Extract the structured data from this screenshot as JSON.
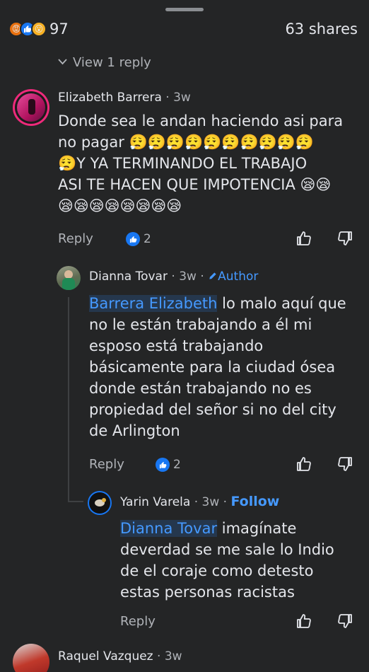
{
  "reactions": {
    "count": "97",
    "icons": [
      "angry-reaction",
      "like-reaction",
      "wow-reaction"
    ]
  },
  "shares": "63 shares",
  "view_reply": "View 1 reply",
  "comments": [
    {
      "name": "Elizabeth Barrera",
      "time": "3w",
      "text_line1": "Donde sea le andan haciendo asi para",
      "text_line2": "no pagar",
      "text_line3": "Y YA TERMINANDO EL TRABAJO",
      "text_line4": "ASI TE HACEN QUE IMPOTENCIA",
      "emoji_a": "😮‍💨😮‍💨😮‍💨😮‍💨😮‍💨😮‍💨😮‍💨😮‍💨😮‍💨😮‍💨",
      "emoji_b": "😮‍💨",
      "emoji_c": "😪😪",
      "emoji_d": "😪😪😪😪😪😪😪😪",
      "reply_label": "Reply",
      "likes": "2"
    },
    {
      "name": "Dianna Tovar",
      "time": "3w",
      "author_label": "Author",
      "mention": "Barrera Elizabeth",
      "text_line1": " lo malo aquí que",
      "text_line2": "no le están trabajando a él mi",
      "text_line3": "esposo está trabajando",
      "text_line4": "básicamente para la ciudad ósea",
      "text_line5": "donde están trabajando no es",
      "text_line6": "propiedad del señor si no del city",
      "text_line7": "de Arlington",
      "reply_label": "Reply",
      "likes": "2"
    },
    {
      "name": "Yarin Varela",
      "time": "3w",
      "follow_label": "Follow",
      "mention": "Dianna Tovar",
      "text_line1": " imagínate",
      "text_line2": "deverdad se me sale lo Indio",
      "text_line3": "de el coraje como detesto",
      "text_line4": "estas personas  racistas",
      "reply_label": "Reply"
    },
    {
      "name": "Raquel Vazquez",
      "time": "3w"
    }
  ]
}
